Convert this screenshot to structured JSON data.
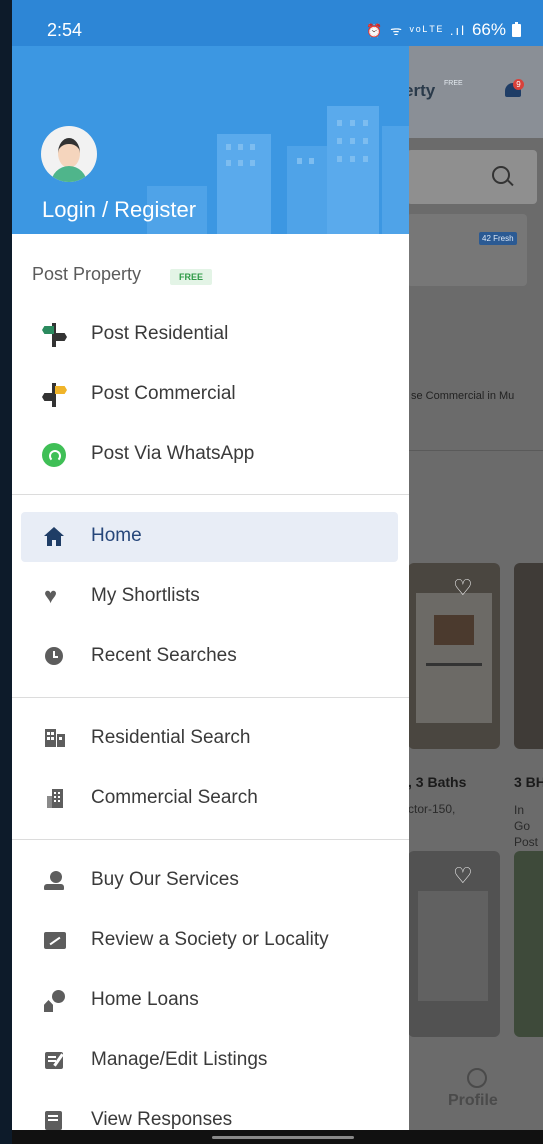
{
  "status_bar": {
    "time": "2:54",
    "icons": "⏰ ᯤ ᵛᵒᴸᵀᴱ .ıl",
    "battery": "66%"
  },
  "drawer": {
    "login_label": "Login / Register",
    "post_property": {
      "label": "Post Property",
      "badge": "FREE"
    },
    "post_items": [
      {
        "label": "Post Residential",
        "icon": "signpost-residential-icon"
      },
      {
        "label": "Post Commercial",
        "icon": "signpost-commercial-icon"
      },
      {
        "label": "Post Via WhatsApp",
        "icon": "whatsapp-icon"
      }
    ],
    "nav_items": [
      {
        "label": "Home",
        "icon": "home-icon",
        "active": true
      },
      {
        "label": "My Shortlists",
        "icon": "heart-icon"
      },
      {
        "label": "Recent Searches",
        "icon": "clock-icon"
      }
    ],
    "search_items": [
      {
        "label": "Residential Search",
        "icon": "building-icon"
      },
      {
        "label": "Commercial Search",
        "icon": "office-building-icon"
      }
    ],
    "service_items": [
      {
        "label": "Buy Our Services",
        "icon": "services-icon"
      },
      {
        "label": "Review a Society or Locality",
        "icon": "review-icon"
      },
      {
        "label": "Home Loans",
        "icon": "home-loan-icon"
      },
      {
        "label": "Manage/Edit Listings",
        "icon": "edit-listing-icon"
      },
      {
        "label": "View Responses",
        "icon": "responses-icon"
      }
    ]
  },
  "background": {
    "title_fragment": "erty",
    "free_tag": "FREE",
    "notification_count": "9",
    "fresh_badge": "42 Fresh",
    "commercial_fragment": "se Commercial in Mu",
    "card1_title": ", 3 Baths",
    "card1_subtitle": "ctor-150,",
    "card2_title": "3 BH",
    "card2_subtitle_1": "In Go",
    "card2_subtitle_2": "Post",
    "profile_tab": "Profile"
  },
  "colors": {
    "header_blue": "#3c97e2",
    "active_bg": "#e8edf6",
    "active_text": "#26467a",
    "free_green": "#2f9a47"
  }
}
